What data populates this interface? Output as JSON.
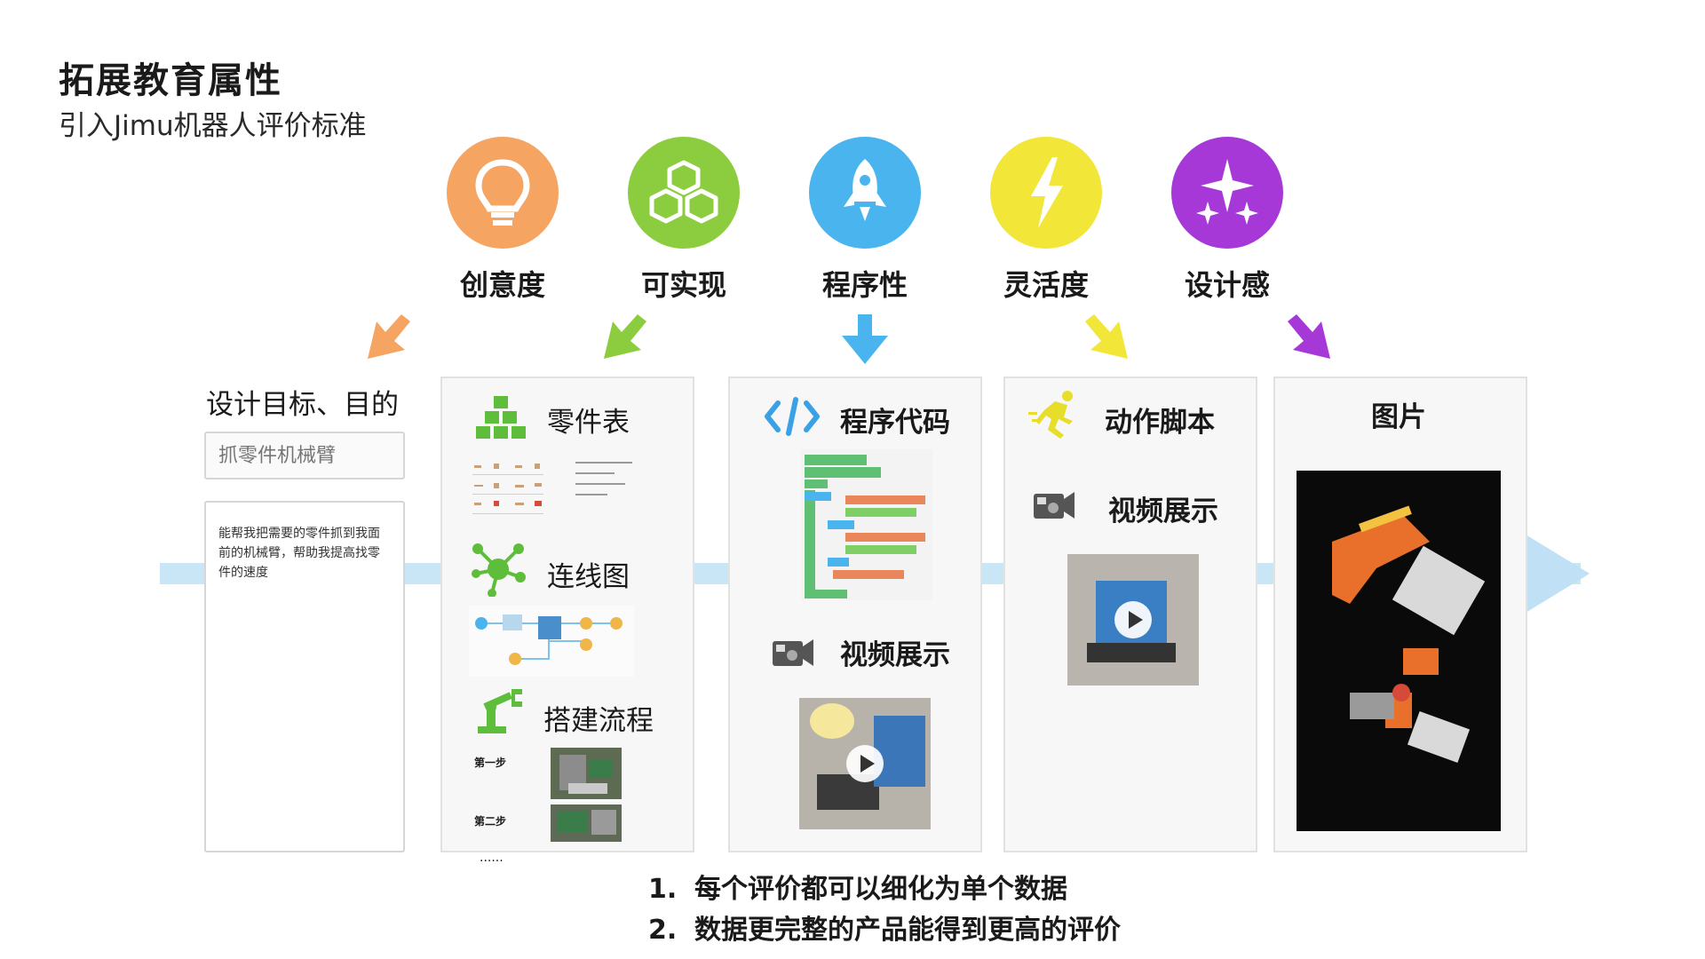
{
  "header": {
    "title": "拓展教育属性",
    "subtitle": "引入Jimu机器人评价标准"
  },
  "colors": {
    "orange": "#f5a461",
    "green": "#8ccd3f",
    "blue": "#4ab4ef",
    "yellow": "#f2e639",
    "purple": "#a638d8",
    "flow": "#c9e6f7"
  },
  "categories": [
    {
      "label": "创意度",
      "icon": "lightbulb-icon",
      "color": "#f5a461"
    },
    {
      "label": "可实现",
      "icon": "cubes-icon",
      "color": "#8ccd3f"
    },
    {
      "label": "程序性",
      "icon": "rocket-icon",
      "color": "#4ab4ef"
    },
    {
      "label": "灵活度",
      "icon": "lightning-icon",
      "color": "#f2e639"
    },
    {
      "label": "设计感",
      "icon": "sparkles-icon",
      "color": "#a638d8"
    }
  ],
  "goal": {
    "label": "设计目标、目的",
    "input_placeholder": "抓零件机械臂",
    "description": "能帮我把需要的零件抓到我面前的机械臂，帮助我提高找零件的速度"
  },
  "panel_parts": {
    "parts_title": "零件表",
    "wiring_title": "连线图",
    "build_title": "搭建流程",
    "step1": "第一步",
    "step2": "第二步",
    "ellipsis": "......"
  },
  "panel_code": {
    "code_title": "程序代码",
    "video_title": "视频展示"
  },
  "panel_motion": {
    "motion_title": "动作脚本",
    "video_title": "视频展示"
  },
  "panel_image": {
    "image_title": "图片"
  },
  "notes": [
    {
      "num": "1.",
      "text": "每个评价都可以细化为单个数据"
    },
    {
      "num": "2.",
      "text": "数据更完整的产品能得到更高的评价"
    }
  ]
}
